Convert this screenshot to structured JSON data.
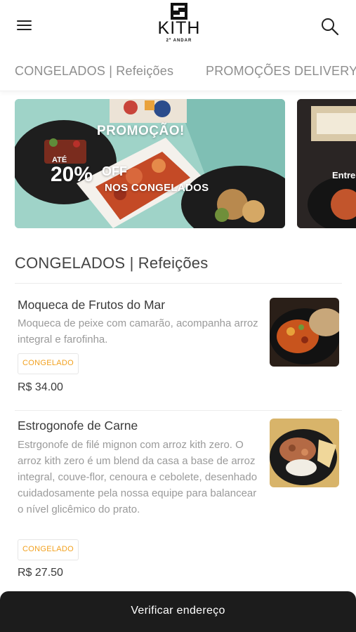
{
  "header": {
    "brand": "KITH",
    "brand_sub": "2º ANDAR",
    "menu_icon": "hamburger-menu-icon",
    "search_icon": "search-icon"
  },
  "tabs": [
    {
      "label": "CONGELADOS | Refeições"
    },
    {
      "label": "PROMOÇÕES DELIVERY"
    }
  ],
  "banners": [
    {
      "title": "PROMOÇÃO!",
      "prefix": "ATÉ",
      "percent": "20%",
      "off": "OFF",
      "subtitle": "NOS CONGELADOS"
    },
    {
      "text": "Entre"
    }
  ],
  "section": {
    "title": "CONGELADOS | Refeições"
  },
  "items": [
    {
      "name": "Moqueca de Frutos do Mar",
      "description": "Moqueca de peixe com camarão, acompanha arroz integral e farofinha.",
      "badge": "CONGELADO",
      "price": "R$ 34.00"
    },
    {
      "name": "Estrogonofe de Carne",
      "description": "Estrgonofe de filé mignon com arroz kith zero. O arroz kith zero é um blend da casa a base de arroz integral, couve-flor, cenoura e cebolete, desenhado cuidadosamente pela nossa equipe para balancear o nível glicêmico do prato.",
      "badge": "CONGELADO",
      "price": "R$ 27.50"
    }
  ],
  "bottom_bar": {
    "label": "Verificar endereço"
  },
  "colors": {
    "badge_text": "#f2a11f",
    "bottom_bar": "#1c1c1c",
    "banner_bg": "#9fd3c8"
  }
}
